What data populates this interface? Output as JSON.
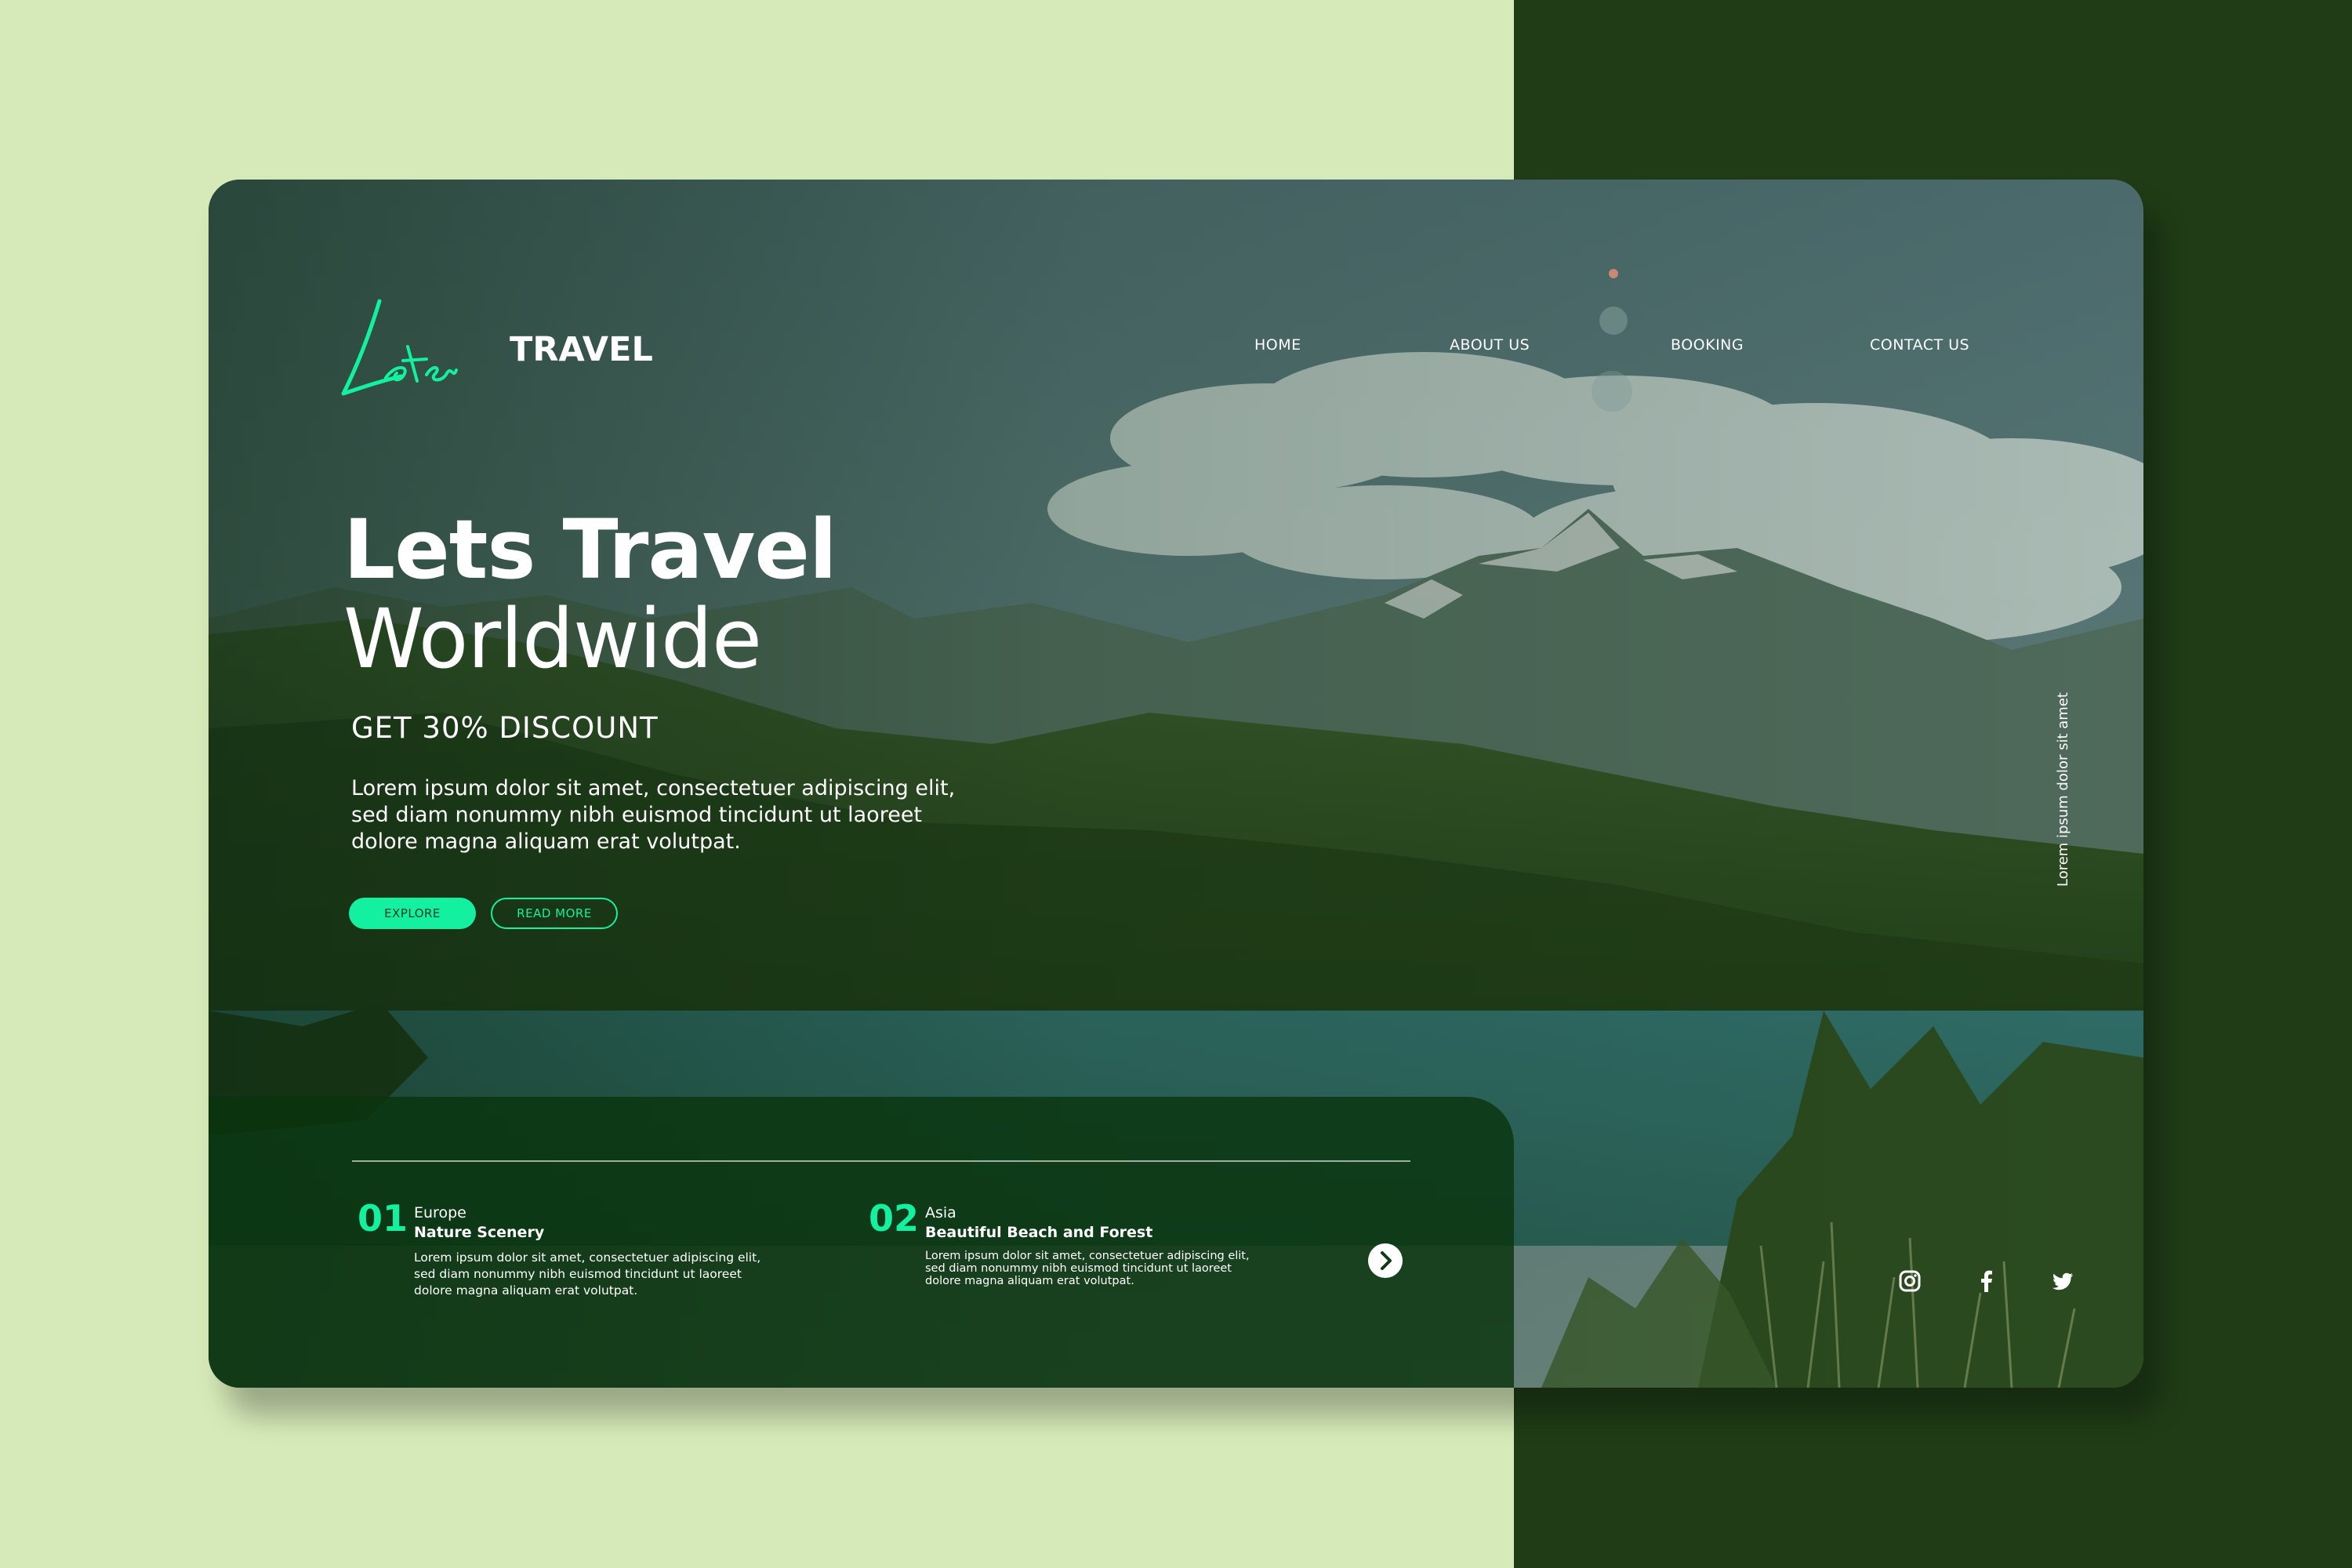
{
  "brand": {
    "script": "Lets",
    "name": "TRAVEL",
    "accent_color": "#12f0a0"
  },
  "nav": {
    "items": [
      {
        "label": "HOME"
      },
      {
        "label": "ABOUT US"
      },
      {
        "label": "BOOKING"
      },
      {
        "label": "CONTACT US"
      }
    ]
  },
  "hero": {
    "title_line1": "Lets Travel",
    "title_line2": "Worldwide",
    "discount": "GET 30% DISCOUNT",
    "description_lines": [
      "Lorem ipsum dolor sit amet, consectetuer adipiscing elit,",
      "sed diam nonummy nibh euismod tincidunt ut laoreet",
      "dolore magna aliquam erat volutpat."
    ],
    "explore_label": "EXPLORE",
    "read_more_label": "READ MORE"
  },
  "side_text": "Lorem ipsum dolor sit amet",
  "features": [
    {
      "number": "01",
      "region": "Europe",
      "title": "Nature Scenery",
      "description_lines": [
        "Lorem ipsum dolor sit amet, consectetuer adipiscing elit,",
        "sed diam nonummy nibh euismod tincidunt ut laoreet",
        "dolore magna aliquam erat volutpat."
      ]
    },
    {
      "number": "02",
      "region": "Asia",
      "title": "Beautiful Beach and Forest",
      "description_lines": [
        "Lorem ipsum dolor sit amet, consectetuer adipiscing elit,",
        "sed diam nonummy nibh euismod tincidunt ut laoreet",
        "dolore magna aliquam erat volutpat."
      ]
    }
  ],
  "social": {
    "icons": [
      "instagram-icon",
      "facebook-icon",
      "twitter-icon"
    ]
  },
  "colors": {
    "page_bg_light": "#d6eab9",
    "page_bg_dark": "#1f3c16",
    "accent": "#12f0a0"
  }
}
